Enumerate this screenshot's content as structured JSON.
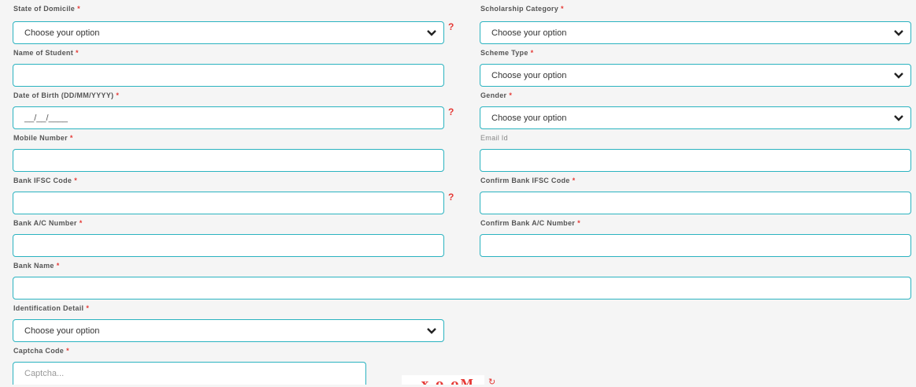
{
  "form": {
    "state_label": "State of Domicile",
    "state_value": "Choose your option",
    "scholarship_label": "Scholarship Category",
    "scholarship_value": "Choose your option",
    "name_label": "Name of Student",
    "name_value": "",
    "scheme_label": "Scheme Type",
    "scheme_value": "Choose your option",
    "dob_label": "Date of Birth (DD/MM/YYYY)",
    "dob_value": "__/__/____",
    "gender_label": "Gender",
    "gender_value": "Choose your option",
    "mobile_label": "Mobile Number",
    "mobile_value": "",
    "email_label": "Email Id",
    "email_value": "",
    "ifsc_label": "Bank IFSC Code",
    "ifsc_value": "",
    "confirm_ifsc_label": "Confirm Bank IFSC Code",
    "confirm_ifsc_value": "",
    "account_label": "Bank A/C Number",
    "account_value": "",
    "confirm_account_label": "Confirm Bank A/C Number",
    "confirm_account_value": "",
    "bank_name_label": "Bank Name",
    "bank_name_value": "",
    "identification_label": "Identification Detail",
    "identification_value": "Choose your option",
    "captcha_label": "Captcha Code",
    "captcha_placeholder": "Captcha...",
    "captcha_text": "x o oM",
    "required_mark": "*",
    "help_mark": "?"
  },
  "colors": {
    "accent": "#2bb3c0",
    "required": "#e53935",
    "background": "#f5f5f5"
  },
  "icons": {
    "select_arrow": "chevron-down-icon",
    "help": "question-mark-icon",
    "refresh": "refresh-icon"
  }
}
